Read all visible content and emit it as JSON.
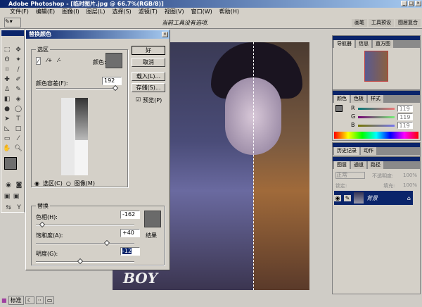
{
  "window": {
    "title": "Adobe Photoshop - [临时图片.jpg @ 66.7%(RGB/8)]"
  },
  "menu": [
    "文件(F)",
    "编辑(E)",
    "图像(I)",
    "图层(L)",
    "选择(S)",
    "滤镜(T)",
    "视图(V)",
    "窗口(W)",
    "帮助(H)"
  ],
  "options_bar": {
    "hint": "当前工具没有选项.",
    "palette_tabs": [
      "画笔",
      "工具预设",
      "图层复合"
    ]
  },
  "dialog": {
    "title": "替换颜色",
    "selection_group": "选区",
    "color_label": "颜色:",
    "tolerance_label": "颜色容差(F):",
    "tolerance_value": "192",
    "tolerance_level": 192,
    "radio_selection": "选区(C)",
    "radio_image": "图像(M)",
    "radio_checked": "selection",
    "replace_group": "替换",
    "hue_label": "色相(H):",
    "hue_value": "-162",
    "saturation_label": "饱和度(A):",
    "saturation_value": "+40",
    "lightness_label": "明度(G):",
    "lightness_value": "-12",
    "result_label": "结果",
    "ok": "好",
    "cancel": "取消",
    "load": "载入(L)...",
    "save": "存储(S)...",
    "preview_label": "预览(P)",
    "preview_checked": true,
    "sample_color": "#6e6e6e",
    "result_color": "#6a6a6a"
  },
  "canvas": {
    "text": "BOY"
  },
  "navigator": {
    "tabs": [
      "导航器",
      "信息",
      "直方图"
    ]
  },
  "color_panel": {
    "tabs": [
      "颜色",
      "色板",
      "样式"
    ],
    "channels": [
      {
        "label": "R",
        "value": "119"
      },
      {
        "label": "G",
        "value": "119"
      },
      {
        "label": "B",
        "value": "119"
      }
    ]
  },
  "history_panel": {
    "tabs": [
      "历史记录",
      "动作"
    ]
  },
  "layers_panel": {
    "tabs": [
      "图层",
      "通道",
      "路径"
    ],
    "blend_mode": "正常",
    "opacity_label": "不透明度:",
    "opacity": "100%",
    "lock_label": "锁定:",
    "fill_label": "填充:",
    "fill": "100%",
    "layer_name": "背景"
  },
  "status": {
    "mode": "标准"
  }
}
